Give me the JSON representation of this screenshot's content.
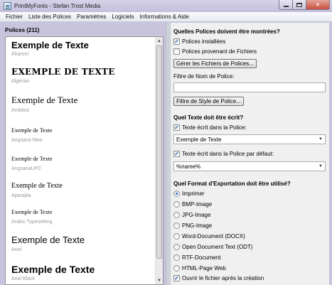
{
  "window": {
    "title": "PrintMyFonts - Stefan Trost Media",
    "close_glyph": "×"
  },
  "menu": [
    "Fichier",
    "Liste des Polices",
    "Paramètres",
    "Logiciels",
    "Informations & Aide"
  ],
  "font_list": {
    "header": "Polices (211)",
    "items": [
      {
        "sample": "Exemple de Texte",
        "name": "Aharoni"
      },
      {
        "sample": "EXEMPLE DE TEXTE",
        "name": "Algerian"
      },
      {
        "sample": "Exemple de Texte",
        "name": "Andalus"
      },
      {
        "sample": "Exemple de Texte",
        "name": "Angsana New"
      },
      {
        "sample": "Exemple de Texte",
        "name": "AngsanaUPC"
      },
      {
        "sample": "Exemple de Texte",
        "name": "Aparajita"
      },
      {
        "sample": "Exemple de Texte",
        "name": "Arabic Typesetting"
      },
      {
        "sample": "Exemple de Texte",
        "name": "Arial"
      },
      {
        "sample": "Exemple de Texte",
        "name": "Arial Black"
      }
    ]
  },
  "options": {
    "show_title": "Quelles Polices doivent être montrées?",
    "installed_label": "Polices installées",
    "installed_checked": true,
    "from_files_label": "Polices provenant de Fichiers",
    "from_files_checked": false,
    "manage_files_button": "Gérer les Fichiers de Polices...",
    "name_filter_label": "Filtre de Nom de Police:",
    "name_filter_value": "",
    "style_filter_button": "Filtre de Style de Police...",
    "text_title": "Quel Texte doit être écrit?",
    "text_in_font_label": "Texte écrit dans la Police:",
    "text_in_font_checked": true,
    "text_in_font_value": "Exemple de Texte",
    "text_default_label": "Texte écrit dans la Police par défaut:",
    "text_default_checked": true,
    "text_default_value": "%name%",
    "export_title": "Quel Format d'Exportation doit être utilisé?",
    "export_formats": [
      {
        "label": "Imprimer",
        "selected": true
      },
      {
        "label": "BMP-Image",
        "selected": false
      },
      {
        "label": "JPG-Image",
        "selected": false
      },
      {
        "label": "PNG-Image",
        "selected": false
      },
      {
        "label": "Word-Document (DOCX)",
        "selected": false
      },
      {
        "label": "Open Document Text (ODT)",
        "selected": false
      },
      {
        "label": "RTF-Document",
        "selected": false
      },
      {
        "label": "HTML-Page Web",
        "selected": false
      }
    ],
    "open_after_label": "Ouvrir le fichier après la création",
    "open_after_checked": true
  },
  "icons": {
    "check_glyph": "✓",
    "up_arrow": "▲",
    "down_arrow": "▼",
    "combo_arrow": "▼"
  }
}
